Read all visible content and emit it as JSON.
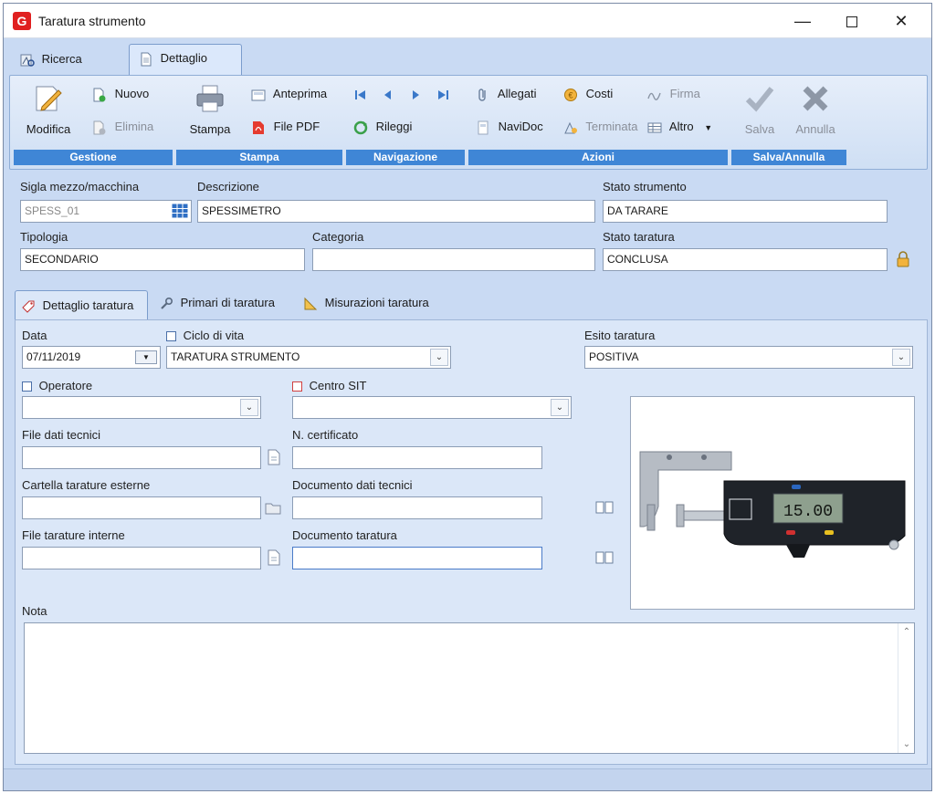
{
  "window": {
    "title": "Taratura strumento"
  },
  "main_tabs": [
    {
      "label": "Ricerca"
    },
    {
      "label": "Dettaglio"
    }
  ],
  "ribbon": {
    "gestione": {
      "group_label": "Gestione",
      "modifica": "Modifica",
      "nuovo": "Nuovo",
      "elimina": "Elimina"
    },
    "stampa": {
      "group_label": "Stampa",
      "stampa": "Stampa",
      "anteprima": "Anteprima",
      "file_pdf": "File PDF"
    },
    "navigazione": {
      "group_label": "Navigazione",
      "rileggi": "Rileggi"
    },
    "azioni": {
      "group_label": "Azioni",
      "allegati": "Allegati",
      "costi": "Costi",
      "firma": "Firma",
      "navidoc": "NaviDoc",
      "terminata": "Terminata",
      "altro": "Altro"
    },
    "salva_annulla": {
      "group_label": "Salva/Annulla",
      "salva": "Salva",
      "annulla": "Annulla"
    }
  },
  "header": {
    "sigla_label": "Sigla mezzo/macchina",
    "sigla_value": "SPESS_01",
    "descrizione_label": "Descrizione",
    "descrizione_value": "SPESSIMETRO",
    "stato_strumento_label": "Stato strumento",
    "stato_strumento_value": "DA TARARE",
    "tipologia_label": "Tipologia",
    "tipologia_value": "SECONDARIO",
    "categoria_label": "Categoria",
    "categoria_value": "",
    "stato_taratura_label": "Stato taratura",
    "stato_taratura_value": "CONCLUSA"
  },
  "inner_tabs": [
    {
      "label": "Dettaglio taratura"
    },
    {
      "label": "Primari di taratura"
    },
    {
      "label": "Misurazioni taratura"
    }
  ],
  "detail": {
    "data_label": "Data",
    "data_value": "07/11/2019",
    "ciclo_label": "Ciclo di vita",
    "ciclo_value": "TARATURA STRUMENTO",
    "esito_label": "Esito taratura",
    "esito_value": "POSITIVA",
    "operatore_label": "Operatore",
    "operatore_value": "",
    "centro_label": "Centro SIT",
    "centro_value": "",
    "file_dati_label": "File dati tecnici",
    "file_dati_value": "",
    "certificato_label": "N. certificato",
    "certificato_value": "",
    "cartella_label": "Cartella tarature esterne",
    "cartella_value": "",
    "doc_dati_label": "Documento dati tecnici",
    "doc_dati_value": "",
    "file_tarature_label": "File tarature interne",
    "file_tarature_value": "",
    "doc_taratura_label": "Documento taratura",
    "doc_taratura_value": "",
    "nota_label": "Nota",
    "nota_value": ""
  },
  "device_display": "15.00",
  "colors": {
    "ribbon_group": "#3f86d6",
    "window_bg": "#c9daf3",
    "panel_bg": "#dbe7f8"
  }
}
